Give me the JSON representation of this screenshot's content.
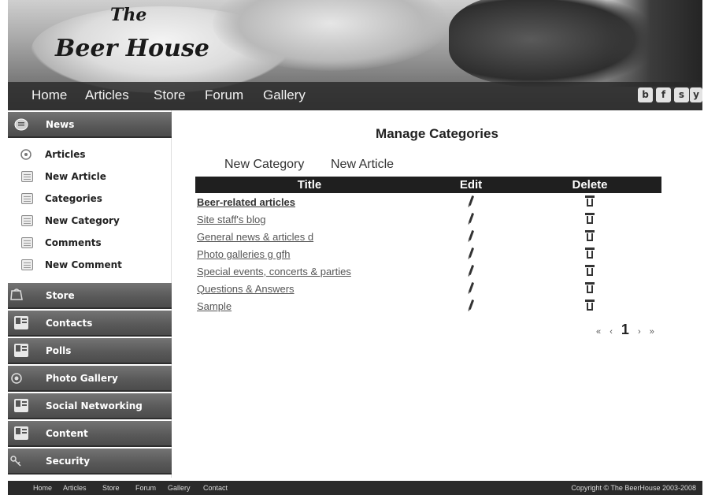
{
  "header": {
    "logo_line1": "The",
    "logo_line2": "Beer House"
  },
  "topnav": {
    "items": [
      "Home",
      "Articles",
      "Store",
      "Forum",
      "Gallery"
    ],
    "social": [
      "b",
      "f",
      "s",
      "y"
    ]
  },
  "sidebar": {
    "news": "News",
    "news_items": [
      "Articles",
      "New Article",
      "Categories",
      "New Category",
      "Comments",
      "New Comment"
    ],
    "sections": [
      "Store",
      "Contacts",
      "Polls",
      "Photo Gallery",
      "Social Networking",
      "Content",
      "Security"
    ]
  },
  "main": {
    "title": "Manage Categories",
    "new_category": "New Category",
    "new_article": "New Article",
    "columns": [
      "Title",
      "Edit",
      "Delete"
    ],
    "rows": [
      "Beer-related articles",
      "Site staff's blog",
      "General news & articles d",
      "Photo galleries g gfh",
      "Special events, concerts & parties",
      "Questions & Answers",
      "Sample"
    ],
    "pager": {
      "first": "«",
      "prev": "‹",
      "current": "1",
      "next": "›",
      "last": "»"
    }
  },
  "footer": {
    "links": [
      "Home",
      "Articles",
      "Store",
      "Forum",
      "Gallery",
      "Contact"
    ],
    "copyright": "Copyright © The BeerHouse 2003-2008"
  }
}
